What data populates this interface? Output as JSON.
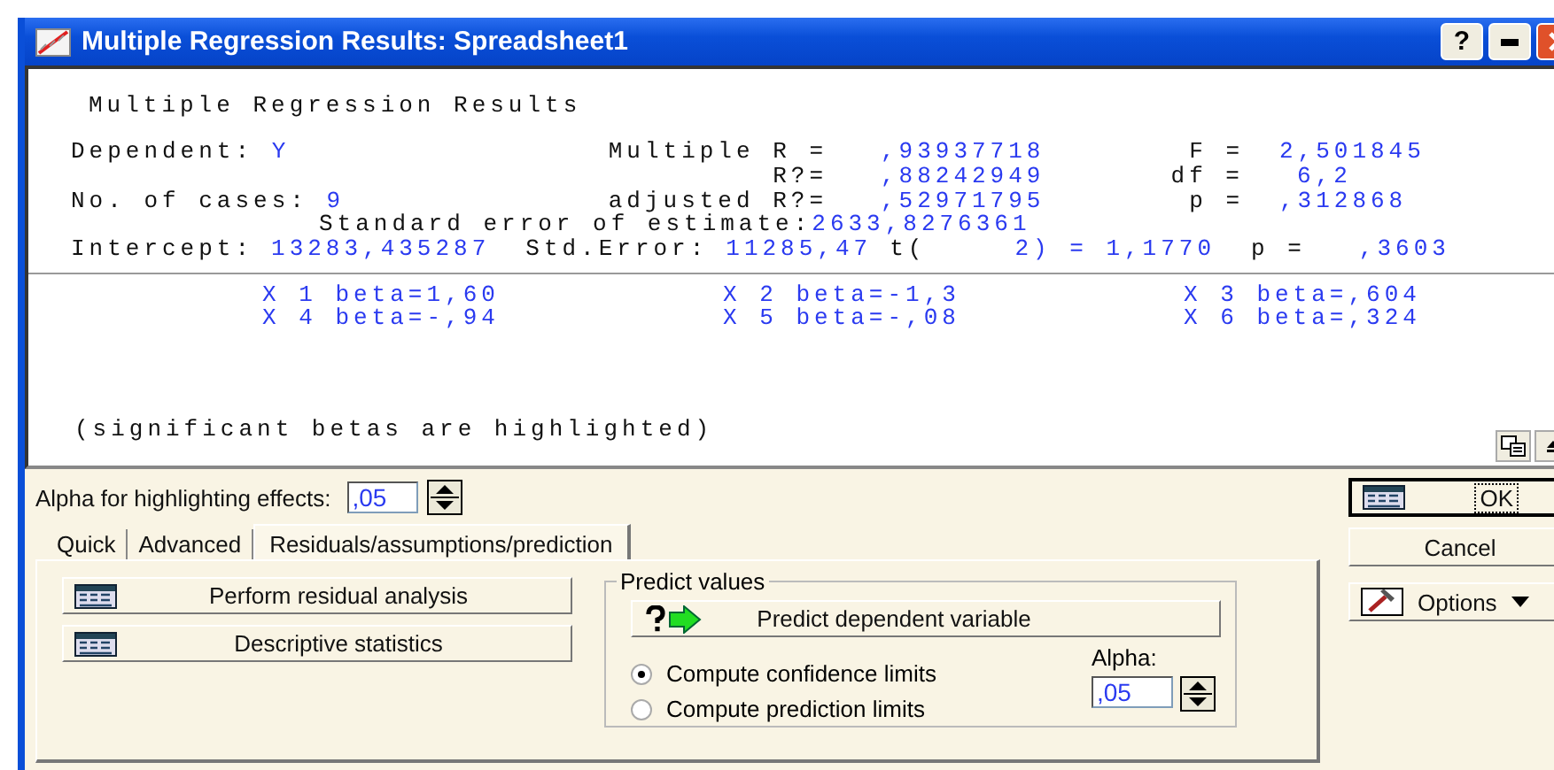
{
  "window": {
    "title": "Multiple Regression Results: Spreadsheet1",
    "help_button": "?"
  },
  "results": {
    "title": "Multiple Regression Results",
    "dependent": {
      "label": "Dependent:",
      "value": "Y"
    },
    "cases": {
      "label": "No. of cases:",
      "value": "9"
    },
    "multiple_r": {
      "label": "Multiple R =",
      "value": ",93937718"
    },
    "r_squared": {
      "label": "R?=",
      "value": ",88242949"
    },
    "adjusted_r_squared": {
      "label": "adjusted R?=",
      "value": ",52971795"
    },
    "f": {
      "label": "F =",
      "value": "2,501845"
    },
    "df": {
      "label": "df =",
      "value": "6,2"
    },
    "p": {
      "label": "p =",
      "value": ",312868"
    },
    "std_error_estimate": {
      "label": "Standard error of estimate:",
      "value": "2633,8276361"
    },
    "intercept_line": [
      {
        "kind": "label",
        "text": "Intercept:"
      },
      {
        "kind": "value",
        "text": "13283,435287"
      },
      {
        "kind": "label",
        "text": "Std.Error:"
      },
      {
        "kind": "value",
        "text": "11285,47"
      },
      {
        "kind": "label",
        "text": "t("
      },
      {
        "kind": "value",
        "text": "2) = 1,1770"
      },
      {
        "kind": "label",
        "text": "p ="
      },
      {
        "kind": "value",
        "text": ",3603"
      }
    ],
    "betas": [
      {
        "text": "X 1 beta=1,60",
        "highlighted": false
      },
      {
        "text": "X 2 beta=-1,3",
        "highlighted": false
      },
      {
        "text": "X 3 beta=,604",
        "highlighted": false
      },
      {
        "text": "X 4 beta=-,94",
        "highlighted": false
      },
      {
        "text": "X 5 beta=-,08",
        "highlighted": false
      },
      {
        "text": "X 6 beta=,324",
        "highlighted": false
      }
    ],
    "note": "(significant betas are highlighted)"
  },
  "alpha_field": {
    "label": "Alpha for highlighting effects:",
    "value": ",05"
  },
  "tabs": [
    {
      "label": "Quick",
      "selected": false
    },
    {
      "label": "Advanced",
      "selected": false
    },
    {
      "label": "Residuals/assumptions/prediction",
      "selected": true
    }
  ],
  "action_buttons": [
    "Perform residual analysis",
    "Descriptive statistics"
  ],
  "predict_group": {
    "title": "Predict values",
    "button": "Predict dependent variable",
    "options": [
      {
        "label": "Compute confidence limits",
        "selected": true
      },
      {
        "label": "Compute prediction limits",
        "selected": false
      }
    ],
    "alpha_label": "Alpha:",
    "alpha_value": ",05"
  },
  "side_buttons": {
    "ok": "OK",
    "cancel": "Cancel",
    "options": "Options"
  }
}
